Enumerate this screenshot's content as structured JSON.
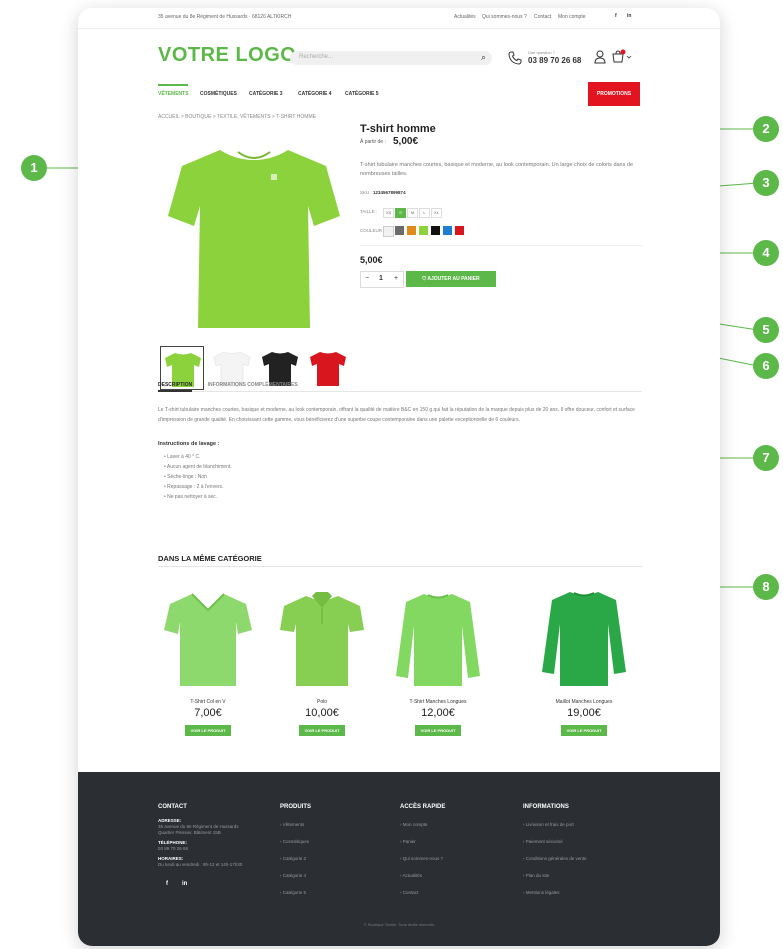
{
  "topbar": {
    "address": "35 avenue du 8e Régiment de Hussards · 68126 ALTKIRCH",
    "links": [
      "Actualités",
      "Qui sommes-nous ?",
      "Contact",
      "Mon compte"
    ],
    "social": [
      "f",
      "in"
    ]
  },
  "header": {
    "logo": "VOTRE LOGO",
    "search_placeholder": "Recherche...",
    "phone_label": "Une question ?",
    "phone_number": "03 89 70 26 68"
  },
  "nav": {
    "items": [
      "VÊTEMENTS",
      "COSMÉTIQUES",
      "CATÉGORIE 3",
      "CATÉGORIE 4",
      "CATÉGORIE 5"
    ],
    "promo": "PROMOTIONS"
  },
  "breadcrumb": "ACCUEIL  >  BOUTIQUE  >  TEXTILE, VÊTEMENTS  >  T-SHIRT HOMME",
  "product": {
    "title": "T-shirt homme",
    "from_label": "À partir de :",
    "from_price": "5,00€",
    "description": "T-shirt tubulaire manches courtes, basique et moderne, au look contemporain. Un large choix de coloris dans de nombreuses tailles.",
    "sku_label": "SKU :",
    "sku": "1234567899874",
    "size_label": "TAILLE :",
    "sizes": [
      "XS",
      "S",
      "M",
      "L",
      "XL"
    ],
    "active_size": "S",
    "color_label": "COULEUR :",
    "colors": [
      "#f1f1f1",
      "#6b6b6b",
      "#e08a1e",
      "#8cd23c",
      "#111111",
      "#1e7fd0",
      "#d8161d"
    ],
    "price": "5,00€",
    "qty_minus": "−",
    "qty_value": "1",
    "qty_plus": "+",
    "add_to_cart": "AJOUTER AU PANIER"
  },
  "tabs": [
    "DESCRIPTION",
    "INFORMATIONS COMPLÉMENTAIRES"
  ],
  "long_description": "Le T-shirt tubulaire manches courtes, basique et moderne, au look contemporain, offrant la qualité de matière B&C en 150 g qui fait la réputation de la marque depuis plus de 20 ans. Il offre douceur, confort et surface d'impression de grande qualité. En choisissant cette gamme, vous bénéficierez d'une superbe coupe contemporaine dans une palette exceptionnelle de 6 couleurs.",
  "wash_title": "Instructions de lavage :",
  "wash_items": [
    "Laver à 40 ° C.",
    "Aucun agent de blanchiment.",
    "Sèche-linge : Non",
    "Repassage : 2 à l'envers.",
    "Ne pas nettoyer à sec."
  ],
  "related_title": "DANS LA MÊME CATÉGORIE",
  "related": [
    {
      "name": "T-Shirt Col en V",
      "price": "7,00€",
      "button": "VOIR LE PRODUIT"
    },
    {
      "name": "Polo",
      "price": "10,00€",
      "button": "VOIR LE PRODUIT"
    },
    {
      "name": "T-Shirt Manches Longues",
      "price": "12,00€",
      "button": "VOIR LE PRODUIT"
    },
    {
      "name": "Maillot Manches Longues",
      "price": "19,00€",
      "button": "VOIR LE PRODUIT"
    }
  ],
  "footer": {
    "contact_title": "CONTACT",
    "address_label": "ADRESSE:",
    "address_1": "35 avenue du 8e Régiment de Hussards",
    "address_2": "Quartier Plessier, Bâtiment 15B",
    "phone_label": "TÉLÉPHONE:",
    "phone": "03 89 70 26 68",
    "hours_label": "HORAIRES:",
    "hours": "Du lundi au vendredi : 9h-12 et 14h-17h30",
    "social": [
      "f",
      "in"
    ],
    "products_title": "PRODUITS",
    "products": [
      "Vêtements",
      "Cosmétiques",
      "Catégorie 3",
      "Catégorie 4",
      "Catégorie 5"
    ],
    "quick_title": "ACCÈS RAPIDE",
    "quick": [
      "Mon compte",
      "Panier",
      "Qui sommes-nous ?",
      "Actualités",
      "Contact"
    ],
    "info_title": "INFORMATIONS",
    "info": [
      "Livraison et frais de port",
      "Paiement sécurisé",
      "Conditions générales de vente",
      "Plan du site",
      "Mentions légales"
    ],
    "copyright": "© Boutique Textile. Tous droits réservés"
  },
  "callouts": [
    "1",
    "2",
    "3",
    "4",
    "5",
    "6",
    "7",
    "8"
  ],
  "colors": {
    "accent": "#5cb848",
    "promo": "#e3141f",
    "footer": "#2b2e33"
  }
}
